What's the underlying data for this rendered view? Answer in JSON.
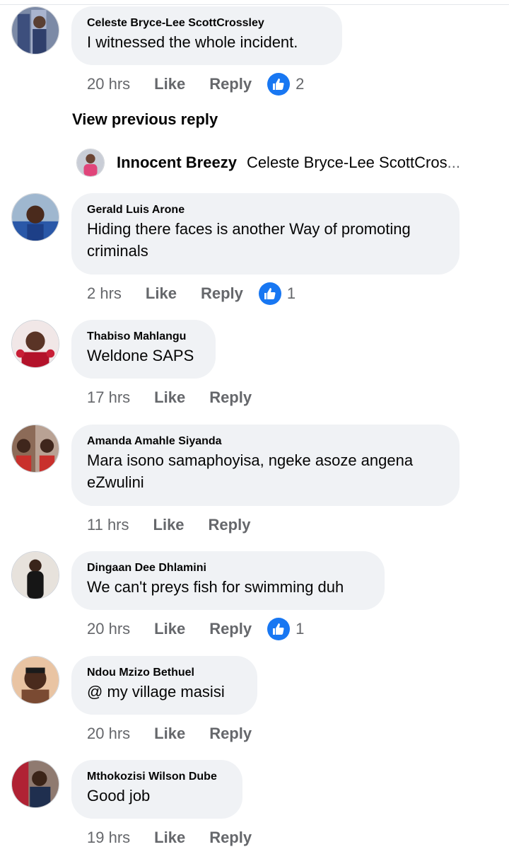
{
  "comments": [
    {
      "author": "Celeste Bryce-Lee ScottCrossley",
      "text": "I witnessed the whole incident.",
      "time": "20 hrs",
      "like": "Like",
      "reply": "Reply",
      "reactions": "2"
    },
    {
      "author": "Gerald Luis Arone",
      "text": "Hiding there faces is another Way of promoting criminals",
      "time": "2 hrs",
      "like": "Like",
      "reply": "Reply",
      "reactions": "1"
    },
    {
      "author": "Thabiso Mahlangu",
      "text": "Weldone SAPS",
      "time": "17 hrs",
      "like": "Like",
      "reply": "Reply"
    },
    {
      "author": "Amanda Amahle Siyanda",
      "text": "Mara isono samaphoyisa,  ngeke asoze angena eZwulini",
      "time": "11 hrs",
      "like": "Like",
      "reply": "Reply"
    },
    {
      "author": "Dingaan Dee Dhlamini",
      "text": "We can't preys fish for swimming duh",
      "time": "20 hrs",
      "like": "Like",
      "reply": "Reply",
      "reactions": "1"
    },
    {
      "author": "Ndou Mzizo Bethuel",
      "text": "@ my  village masisi",
      "time": "20 hrs",
      "like": "Like",
      "reply": "Reply"
    },
    {
      "author": "Mthokozisi Wilson Dube",
      "text": "Good job",
      "time": "19 hrs",
      "like": "Like",
      "reply": "Reply"
    }
  ],
  "view_previous_reply": "View previous reply",
  "reply_preview": {
    "author": "Innocent Breezy",
    "text": "Celeste Bryce-Lee ScottCros",
    "ellipsis": "..."
  },
  "colors": {
    "bubble": "#f0f2f5",
    "secondary_text": "#65676b",
    "like_blue": "#1877f2"
  }
}
